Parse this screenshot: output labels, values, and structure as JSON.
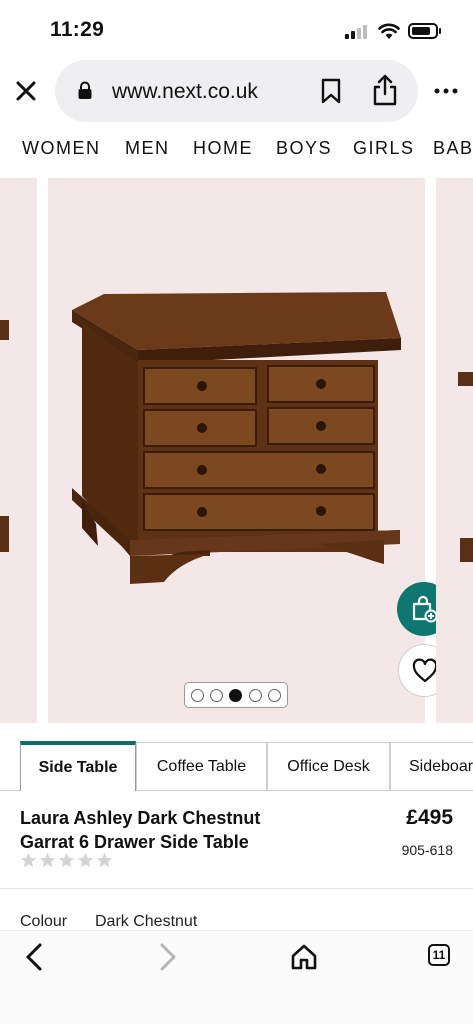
{
  "status_bar": {
    "time": "11:29"
  },
  "browser": {
    "url": "www.next.co.uk",
    "tab_count": "11"
  },
  "categories": [
    "WOMEN",
    "MEN",
    "HOME",
    "BOYS",
    "GIRLS",
    "BAB"
  ],
  "carousel": {
    "slide_count": 5,
    "active_index": 2
  },
  "variants": [
    {
      "label": "Side Table",
      "active": true
    },
    {
      "label": "Coffee Table",
      "active": false
    },
    {
      "label": "Office Desk",
      "active": false
    },
    {
      "label": "Sideboar",
      "active": false
    }
  ],
  "product": {
    "title": "Laura Ashley Dark Chestnut Garrat 6 Drawer Side Table",
    "price": "£495",
    "code": "905-618",
    "rating_stars": 0,
    "max_stars": 5,
    "colour_label": "Colour",
    "colour_value": "Dark Chestnut"
  },
  "colors": {
    "accent": "#0e7770",
    "slide_bg": "#f3e7e7",
    "wood": "#5a3116"
  },
  "icons": {
    "close": "close-icon",
    "lock": "lock-icon",
    "bookmark": "bookmark-icon",
    "share": "share-icon",
    "more": "more-icon",
    "bag": "add-to-bag-icon",
    "heart": "heart-icon",
    "back": "chevron-left-icon",
    "forward": "chevron-right-icon",
    "home": "home-icon",
    "tabs": "tabs-icon"
  }
}
